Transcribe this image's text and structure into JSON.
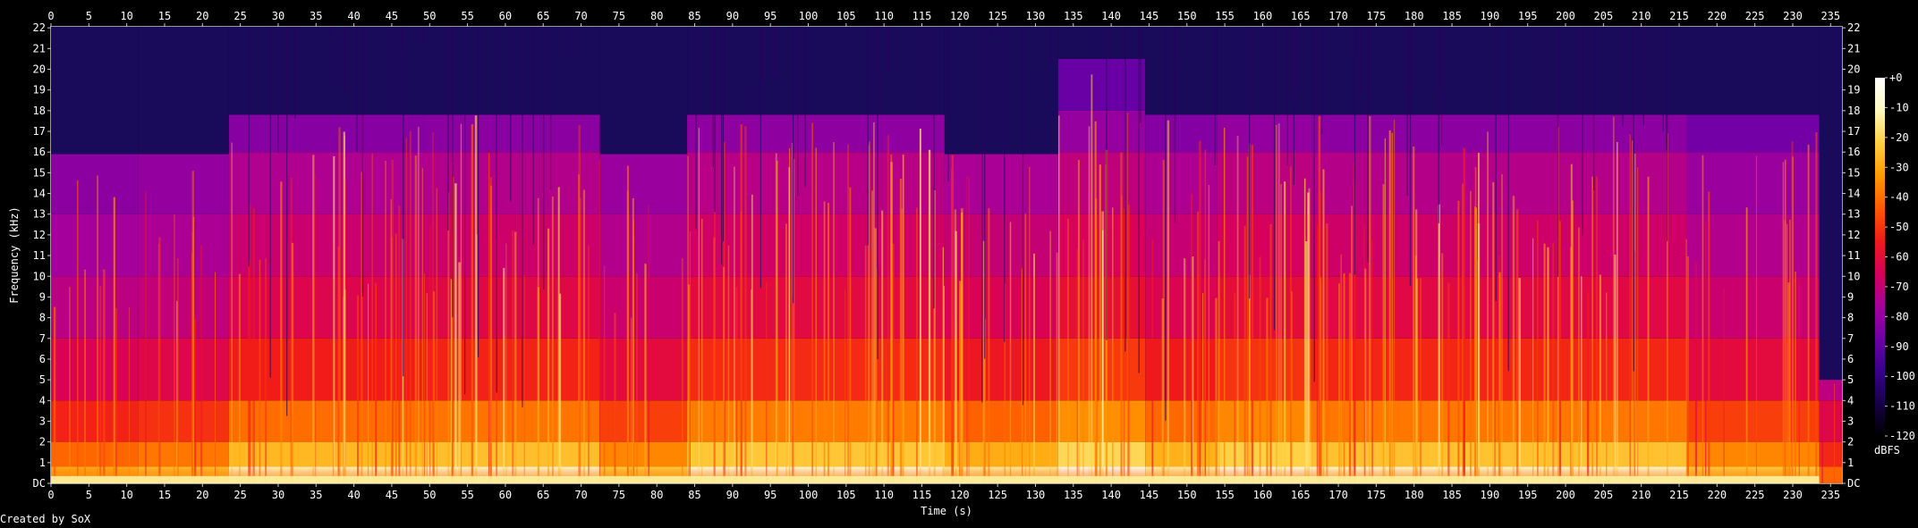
{
  "chart_data": {
    "type": "heatmap",
    "xlabel": "Time (s)",
    "ylabel": "Frequency (kHz)",
    "x_ticks": [
      0,
      5,
      10,
      15,
      20,
      25,
      30,
      35,
      40,
      45,
      50,
      55,
      60,
      65,
      70,
      75,
      80,
      85,
      90,
      95,
      100,
      105,
      110,
      115,
      120,
      125,
      130,
      135,
      140,
      145,
      150,
      155,
      160,
      165,
      170,
      175,
      180,
      185,
      190,
      195,
      200,
      205,
      210,
      215,
      220,
      225,
      230,
      235
    ],
    "y_ticks": [
      "DC",
      "1",
      "2",
      "3",
      "4",
      "5",
      "6",
      "7",
      "8",
      "9",
      "10",
      "11",
      "12",
      "13",
      "14",
      "15",
      "16",
      "17",
      "18",
      "19",
      "20",
      "21",
      "22"
    ],
    "xlim": [
      0,
      236.5
    ],
    "ylim": [
      0,
      22.05
    ],
    "colorbar": {
      "unit": "dBFS",
      "ticks": [
        "+0",
        "-10",
        "-20",
        "-30",
        "-40",
        "-50",
        "-60",
        "-70",
        "-80",
        "-90",
        "-100",
        "-110",
        "-120"
      ],
      "range": [
        -120,
        0
      ],
      "colors": [
        "#000000",
        "#160048",
        "#3a008a",
        "#6e00a8",
        "#a8009a",
        "#d8005a",
        "#f01a1a",
        "#ff5a00",
        "#ff9a00",
        "#ffd040",
        "#fff8c0",
        "#ffffff"
      ]
    },
    "segments": [
      {
        "start": 0,
        "end": 11.5,
        "cutoff_khz": 15.9,
        "level": 0.45
      },
      {
        "start": 11.5,
        "end": 23.5,
        "cutoff_khz": 15.9,
        "level": 0.5
      },
      {
        "start": 23.5,
        "end": 49.5,
        "cutoff_khz": 17.8,
        "level": 0.72
      },
      {
        "start": 49.5,
        "end": 72.5,
        "cutoff_khz": 17.8,
        "level": 0.75
      },
      {
        "start": 72.5,
        "end": 84,
        "cutoff_khz": 15.9,
        "level": 0.55
      },
      {
        "start": 84,
        "end": 118,
        "cutoff_khz": 17.8,
        "level": 0.78
      },
      {
        "start": 118,
        "end": 133,
        "cutoff_khz": 15.9,
        "level": 0.68
      },
      {
        "start": 133,
        "end": 144.5,
        "cutoff_khz": 20.5,
        "level": 0.85
      },
      {
        "start": 144.5,
        "end": 154,
        "cutoff_khz": 17.8,
        "level": 0.7
      },
      {
        "start": 154,
        "end": 166.5,
        "cutoff_khz": 17.8,
        "level": 0.82
      },
      {
        "start": 166.5,
        "end": 216,
        "cutoff_khz": 17.8,
        "level": 0.76
      },
      {
        "start": 216,
        "end": 233.5,
        "cutoff_khz": 17.8,
        "level": 0.55
      },
      {
        "start": 233.5,
        "end": 236.5,
        "cutoff_khz": 5.0,
        "level": 0.25
      }
    ]
  },
  "credit": "Created by SoX"
}
